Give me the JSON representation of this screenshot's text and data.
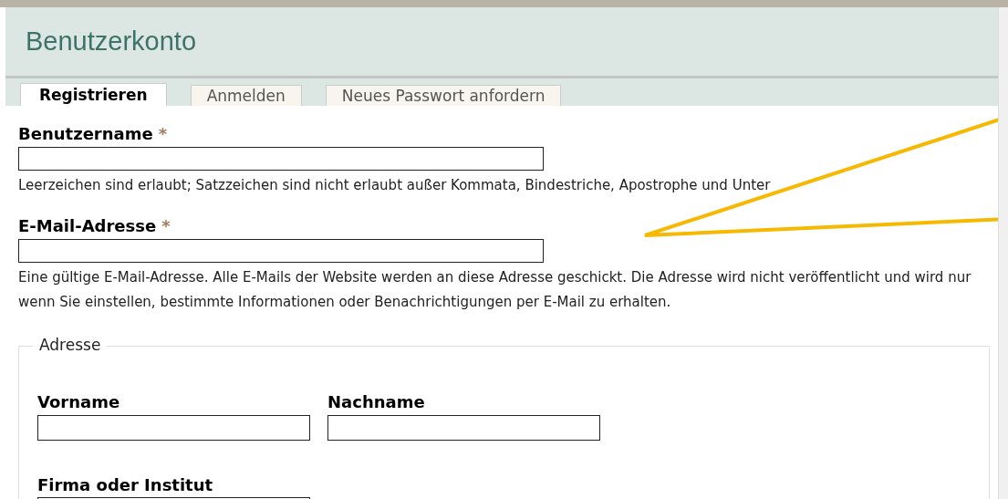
{
  "page": {
    "title": "Benutzerkonto"
  },
  "tabs": [
    {
      "label": "Registrieren",
      "selected": true
    },
    {
      "label": "Anmelden",
      "selected": false
    },
    {
      "label": "Neues Passwort anfordern",
      "selected": false
    }
  ],
  "fields": [
    {
      "label": "Benutzername",
      "required_mark": "*",
      "hint": "Leerzeichen sind erlaubt; Satzzeichen sind nicht erlaubt außer Kommata, Bindestriche, Apostrophe und Unter"
    },
    {
      "label": "E-Mail-Adresse",
      "required_mark": "*",
      "hint": "Eine gültige E-Mail-Adresse. Alle E-Mails der Website werden an diese Adresse geschickt. Die Adresse wird nicht veröffentlicht und wird nur\nwenn Sie einstellen, bestimmte Informationen oder Benachrichtigungen per E-Mail zu erhalten."
    }
  ],
  "address": {
    "legend": "Adresse",
    "name_fields": [
      {
        "label": "Vorname"
      },
      {
        "label": "Nachname"
      }
    ],
    "company_field": {
      "label": "Firma oder Institut"
    }
  }
}
